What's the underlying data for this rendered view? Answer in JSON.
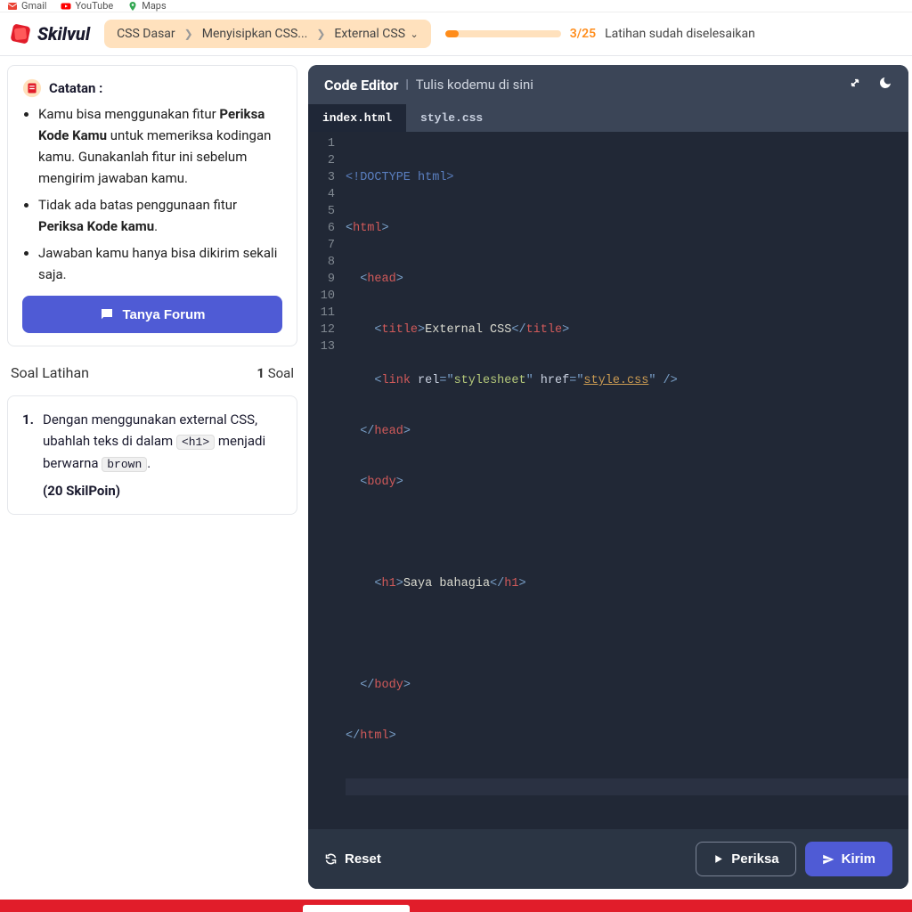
{
  "topbar": {
    "gmail": "Gmail",
    "youtube": "YouTube",
    "maps": "Maps"
  },
  "brand": "Skilvul",
  "breadcrumb": {
    "items": [
      "CSS Dasar",
      "Menyisipkan CSS...",
      "External CSS"
    ]
  },
  "progress": {
    "current": 3,
    "total": 25,
    "text": "3/25",
    "label": "Latihan sudah diselesaikan",
    "percent": 12
  },
  "notes": {
    "title": "Catatan :",
    "item1_pre": "Kamu bisa menggunakan fitur ",
    "item1_bold": "Periksa Kode Kamu",
    "item1_post": " untuk memeriksa kodingan kamu. Gunakanlah fitur ini sebelum mengirim jawaban kamu.",
    "item2_pre": "Tidak ada batas penggunaan fitur ",
    "item2_bold": "Periksa Kode kamu",
    "item2_post": ".",
    "item3": "Jawaban kamu hanya bisa dikirim sekali saja.",
    "forum_btn": "Tanya Forum"
  },
  "soal": {
    "title": "Soal Latihan",
    "count_num": "1",
    "count_label": " Soal",
    "q1_num": "1.",
    "q1_a": "Dengan menggunakan external CSS, ubahlah teks di dalam ",
    "q1_code1": "<h1>",
    "q1_b": " menjadi berwarna ",
    "q1_code2": "brown",
    "q1_c": ".",
    "q1_points": "(20 SkilPoin)"
  },
  "editor": {
    "title": "Code Editor",
    "subtitle": "Tulis kodemu di sini",
    "tabs": [
      "index.html",
      "style.css"
    ],
    "reset": "Reset",
    "check": "Periksa",
    "submit": "Kirim",
    "code": {
      "l1_a": "<!DOCTYPE ",
      "l1_b": "html",
      "l1_c": ">",
      "l2_a": "<",
      "l2_b": "html",
      "l2_c": ">",
      "l3_a": "<",
      "l3_b": "head",
      "l3_c": ">",
      "l4_a": "<",
      "l4_b": "title",
      "l4_c": ">",
      "l4_t": "External CSS",
      "l4_d": "</",
      "l4_e": "title",
      "l4_f": ">",
      "l5_a": "<",
      "l5_b": "link ",
      "l5_r": "rel",
      "l5_eq": "=",
      "l5_q": "\"",
      "l5_v1": "stylesheet",
      "l5_h": " href",
      "l5_v2": "style.css",
      "l5_end": " />",
      "l6_a": "</",
      "l6_b": "head",
      "l6_c": ">",
      "l7_a": "<",
      "l7_b": "body",
      "l7_c": ">",
      "l9_a": "<",
      "l9_b": "h1",
      "l9_c": ">",
      "l9_t": "Saya bahagia",
      "l9_d": "</",
      "l9_e": "h1",
      "l9_f": ">",
      "l11_a": "</",
      "l11_b": "body",
      "l11_c": ">",
      "l12_a": "</",
      "l12_b": "html",
      "l12_c": ">"
    },
    "lines": [
      "1",
      "2",
      "3",
      "4",
      "5",
      "6",
      "7",
      "8",
      "9",
      "10",
      "11",
      "12",
      "13"
    ]
  }
}
